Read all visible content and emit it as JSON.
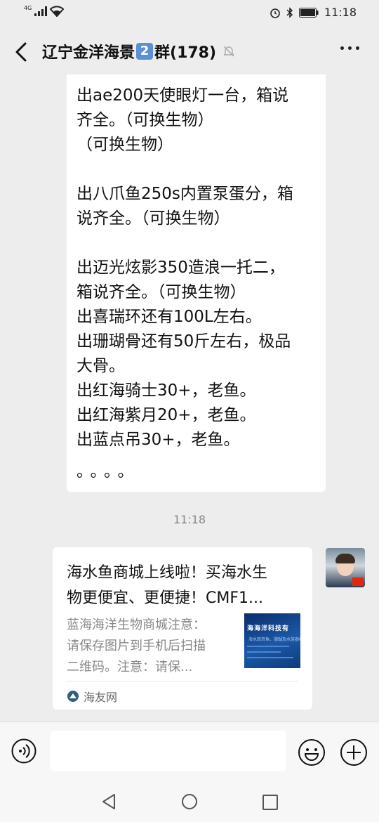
{
  "status_bar": {
    "network": "4G",
    "time": "11:18"
  },
  "header": {
    "title_prefix": "辽宁金洋海景",
    "title_badge": "2",
    "title_suffix": "群(178)"
  },
  "messages": {
    "text_lines": [
      "出ae200天使眼灯一台，箱说",
      "齐全。（可换生物）",
      "（可换生物）",
      "",
      "出八爪鱼250s内置泵蛋分，箱",
      "说齐全。（可换生物）",
      "",
      "出迈光炫影350造浪一托二，",
      "箱说齐全。（可换生物）",
      "出喜瑞环还有100L左右。",
      "出珊瑚骨还有50斤左右，极品",
      "大骨。",
      "出红海骑士30+，老鱼。",
      "出红海紫月20+，老鱼。",
      "出蓝点吊30+，老鱼。",
      "。。。。"
    ],
    "timestamp": "11:18",
    "link_card": {
      "title_lines": [
        "海水鱼商城上线啦！买海水生",
        "物更便宜、更便捷！CMF1..."
      ],
      "desc_lines": [
        "蓝海海洋生物商城注意：",
        "请保存图片到手机后扫描",
        "二维码。注意：请保..."
      ],
      "source": "海友网",
      "thumb_text": "海海洋科技有",
      "thumb_sub": "海水观赏鱼、珊瑚及水族器材"
    }
  },
  "colors": {
    "background": "#ededed",
    "bubble": "#ffffff",
    "badge": "#5b8fd6"
  },
  "icons": [
    "back-arrow-icon",
    "mute-bell-icon",
    "more-dots-icon",
    "voice-icon",
    "emoji-icon",
    "plus-icon",
    "nav-back-icon",
    "nav-home-icon",
    "nav-recent-icon"
  ]
}
